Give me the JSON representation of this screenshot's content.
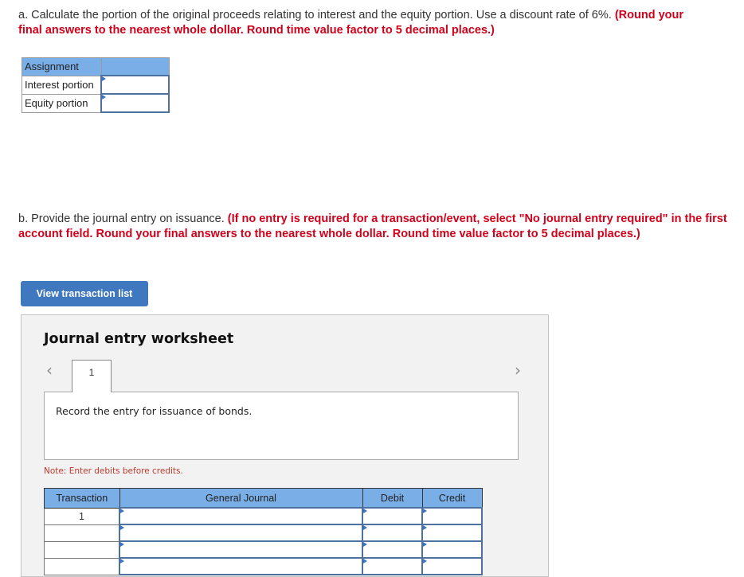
{
  "part_a": {
    "text": "a. Calculate the portion of the original proceeds relating to interest and the equity portion. Use a discount rate of 6%.",
    "instruction_line1": "(Round your",
    "instruction_line2": "final answers to the nearest whole dollar. Round time value factor to 5 decimal places.)"
  },
  "assignment_table": {
    "header": "Assignment",
    "rows": [
      {
        "label": "Interest portion",
        "value": ""
      },
      {
        "label": "Equity portion",
        "value": ""
      }
    ]
  },
  "part_b": {
    "text": "b. Provide the journal entry on issuance.",
    "instruction_line1": "(If no entry is required for a transaction/event, select \"No journal entry required\" in the first",
    "instruction_line2": "account field. Round your final answers to the nearest whole dollar. Round time value factor to 5 decimal places.)"
  },
  "view_button": "View transaction list",
  "worksheet": {
    "title": "Journal entry worksheet",
    "prev_icon": "‹",
    "next_icon": "›",
    "tabs": [
      "1"
    ],
    "description": "Record the entry for issuance of bonds.",
    "note": "Note: Enter debits before credits.",
    "columns": [
      "Transaction",
      "General Journal",
      "Debit",
      "Credit"
    ],
    "rows": [
      {
        "transaction": "1",
        "account": "",
        "debit": "",
        "credit": ""
      },
      {
        "transaction": "",
        "account": "",
        "debit": "",
        "credit": ""
      },
      {
        "transaction": "",
        "account": "",
        "debit": "",
        "credit": ""
      },
      {
        "transaction": "",
        "account": "",
        "debit": "",
        "credit": ""
      }
    ]
  }
}
